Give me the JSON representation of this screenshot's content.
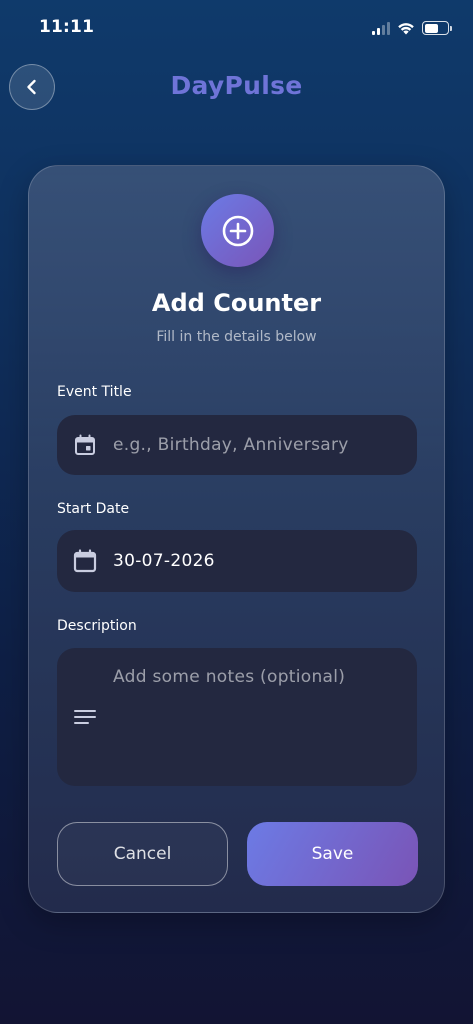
{
  "status_bar": {
    "time": "11:11",
    "battery_level": 0.6
  },
  "header": {
    "app_title": "DayPulse",
    "back_icon": "chevron-left-icon"
  },
  "card": {
    "icon": "add-circle-icon",
    "title": "Add Counter",
    "subtitle": "Fill in the details below",
    "fields": {
      "event_title": {
        "label": "Event Title",
        "placeholder": "e.g., Birthday, Anniversary",
        "value": "",
        "icon": "event-calendar-icon"
      },
      "start_date": {
        "label": "Start Date",
        "value": "30-07-2026",
        "icon": "calendar-icon"
      },
      "description": {
        "label": "Description",
        "placeholder": "Add some notes (optional)",
        "value": "",
        "icon": "notes-lines-icon"
      }
    },
    "buttons": {
      "cancel": "Cancel",
      "save": "Save"
    }
  },
  "colors": {
    "accent_start": "#6c7be5",
    "accent_end": "#7a54b6",
    "title_color": "#6f74d8",
    "field_bg": "#232840"
  }
}
